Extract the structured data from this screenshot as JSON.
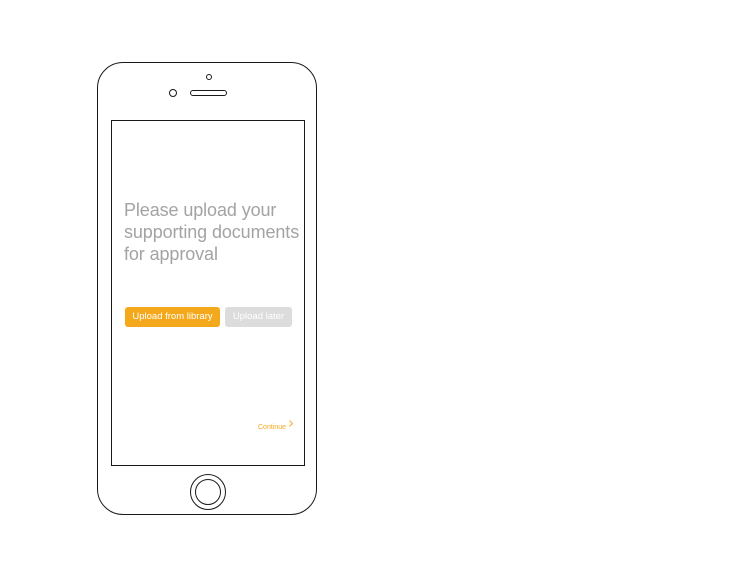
{
  "screen": {
    "headline": "Please upload your supporting documents for approval",
    "buttons": {
      "upload_from_library": "Upload from library",
      "upload_later": "Upload later"
    },
    "continue_label": "Continue"
  },
  "icons": {
    "continue_chevron": "chevron-right-icon"
  },
  "colors": {
    "accent": "#f4a81c",
    "disabled_button": "#dcdcdc",
    "headline_text": "#a3a3a3",
    "device_outline": "#1a1a1a"
  }
}
